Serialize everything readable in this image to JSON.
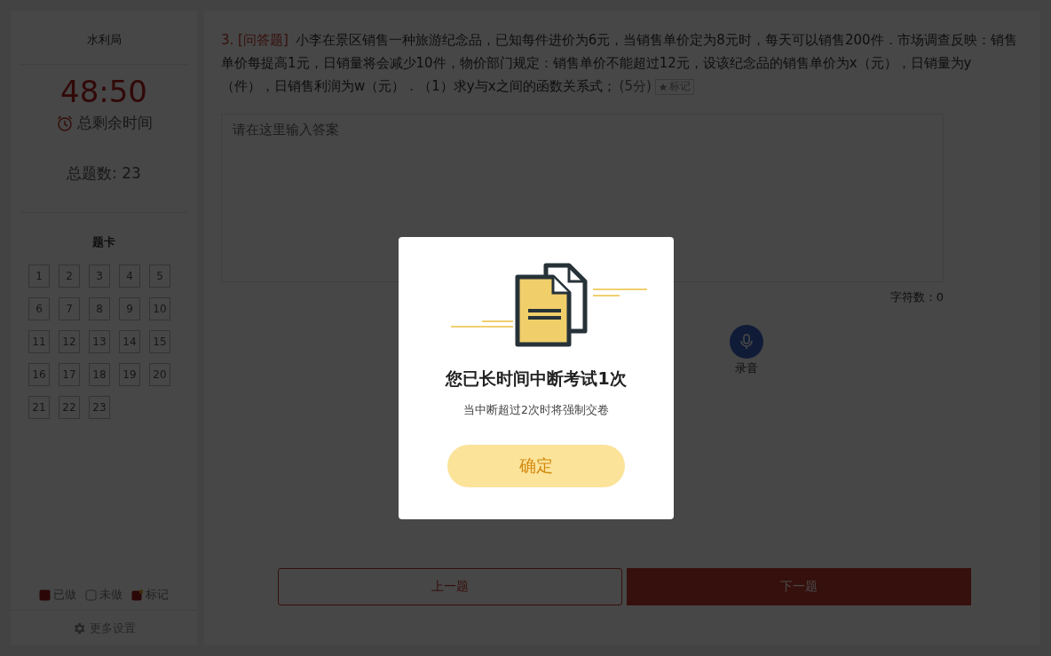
{
  "sidebar": {
    "org": "水利局",
    "timer": "48:50",
    "timer_label": "总剩余时间",
    "total": "总题数: 23",
    "card_title": "题卡",
    "questions": [
      "1",
      "2",
      "3",
      "4",
      "5",
      "6",
      "7",
      "8",
      "9",
      "10",
      "11",
      "12",
      "13",
      "14",
      "15",
      "16",
      "17",
      "18",
      "19",
      "20",
      "21",
      "22",
      "23"
    ],
    "legend": [
      {
        "kind": "done",
        "label": "已做"
      },
      {
        "kind": "todo",
        "label": "未做"
      },
      {
        "kind": "marked",
        "label": "标记"
      }
    ],
    "settings": "更多设置"
  },
  "question": {
    "number": "3.",
    "type": "[问答题]",
    "text": "小李在景区销售一种旅游纪念品，已知每件进价为6元，当销售单价定为8元时，每天可以销售200件．市场调查反映：销售单价每提高1元，日销量将会减少10件，物价部门规定：销售单价不能超过12元，设该纪念品的销售单价为x（元），日销量为y（件），日销售利润为w（元）．（1）求y与x之间的函数关系式；",
    "score": "(5分)",
    "mark_button": "标记"
  },
  "answer": {
    "placeholder": "请在这里输入答案",
    "char_count": "字符数：0"
  },
  "record": {
    "label": "录音"
  },
  "nav": {
    "prev": "上一题",
    "next": "下一题"
  },
  "dialog": {
    "title": "您已长时间中断考试1次",
    "message": "当中断超过2次时将强制交卷",
    "confirm": "确定"
  }
}
